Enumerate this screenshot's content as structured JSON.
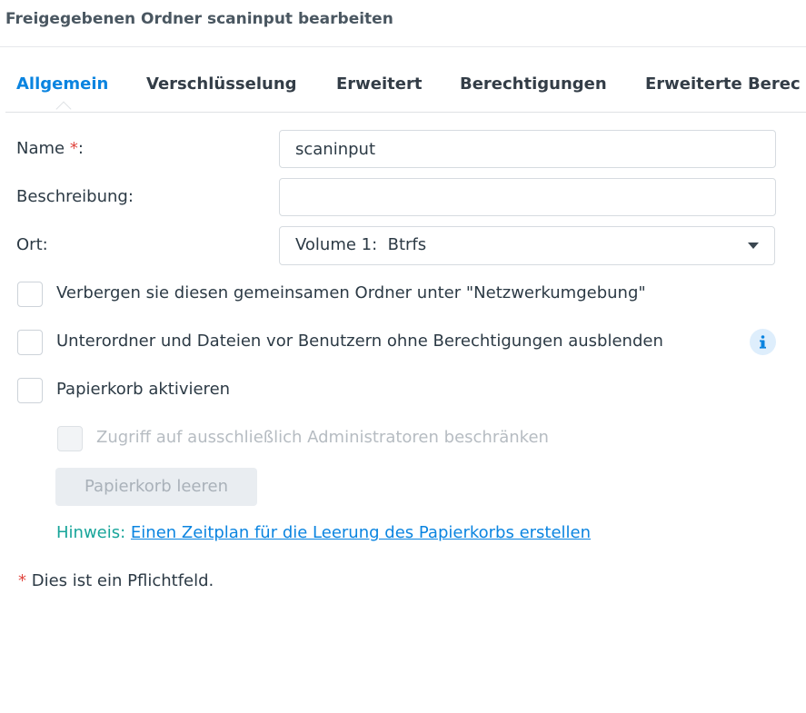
{
  "window": {
    "title": "Freigegebenen Ordner scaninput bearbeiten"
  },
  "tabs": [
    {
      "label": "Allgemein",
      "active": true
    },
    {
      "label": "Verschlüsselung",
      "active": false
    },
    {
      "label": "Erweitert",
      "active": false
    },
    {
      "label": "Berechtigungen",
      "active": false
    },
    {
      "label": "Erweiterte Berec",
      "active": false
    }
  ],
  "form": {
    "name": {
      "label": "Name",
      "required_mark": "*",
      "colon": ":",
      "value": "scaninput"
    },
    "description": {
      "label": "Beschreibung:",
      "value": ""
    },
    "location": {
      "label": "Ort:",
      "value": "Volume 1:  Btrfs"
    }
  },
  "options": {
    "hide_network": {
      "label": "Verbergen sie diesen gemeinsamen Ordner unter \"Netzwerkumgebung\"",
      "checked": false
    },
    "hide_subfolders": {
      "label": "Unterordner und Dateien vor Benutzern ohne Berechtigungen ausblenden",
      "checked": false,
      "icon": "info-icon"
    },
    "recycle_bin": {
      "label": "Papierkorb aktivieren",
      "checked": false
    },
    "admin_only": {
      "label": "Zugriff auf ausschließlich Administratoren beschränken",
      "checked": false,
      "disabled": true
    }
  },
  "buttons": {
    "empty_bin": "Papierkorb leeren"
  },
  "hint": {
    "prefix": "Hinweis:",
    "link": "Einen Zeitplan für die Leerung des Papierkorbs erstellen"
  },
  "footnote": {
    "mark": "*",
    "text": "Dies ist ein Pflichtfeld."
  },
  "colors": {
    "accent": "#0a84e0",
    "required": "#e0453e",
    "hint": "#18a59a"
  }
}
